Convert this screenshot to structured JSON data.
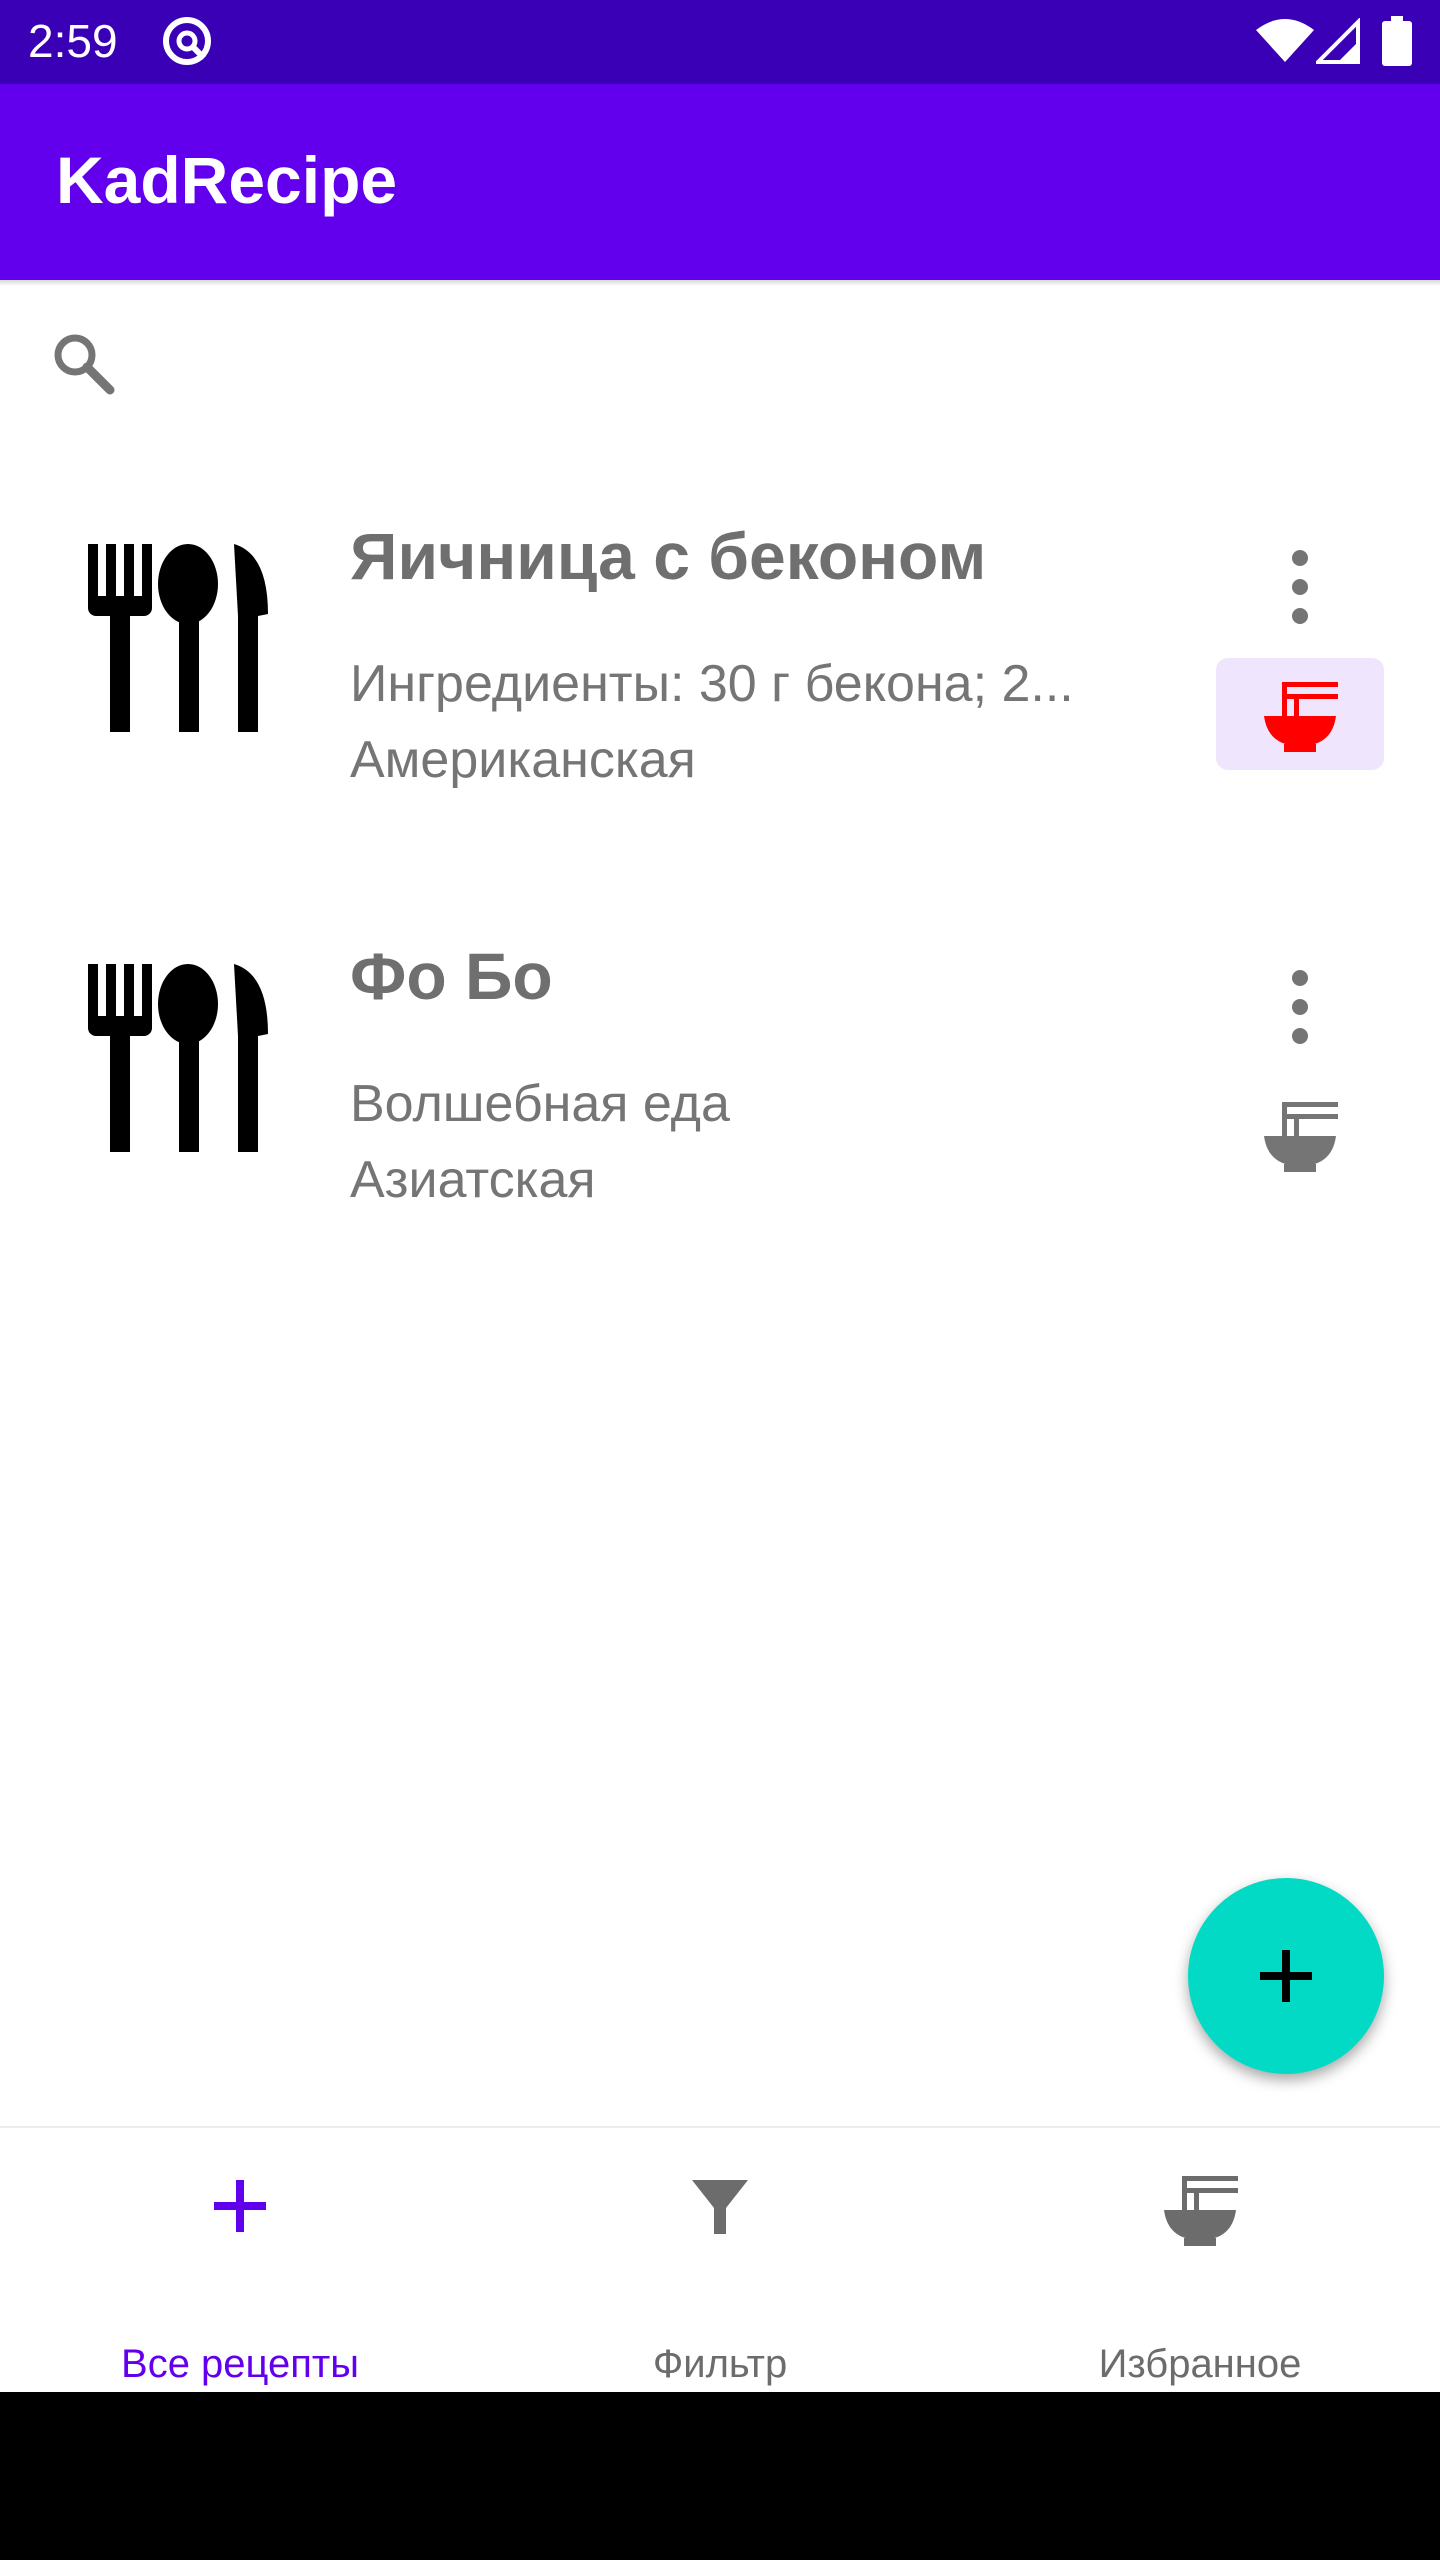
{
  "status_bar": {
    "time": "2:59"
  },
  "app": {
    "title": "KadRecipe"
  },
  "search": {
    "placeholder": ""
  },
  "recipes": [
    {
      "name": "Яичница с беконом",
      "description": "Ингредиенты:  30 г бекона; 2...",
      "cuisine": "Американская",
      "favorite": true
    },
    {
      "name": "Фо Бо",
      "description": "Волшебная еда",
      "cuisine": "Азиатская",
      "favorite": false
    }
  ],
  "bottom_nav": {
    "items": [
      {
        "label": "Все рецепты",
        "icon": "plus-icon",
        "active": true
      },
      {
        "label": "Фильтр",
        "icon": "filter-icon",
        "active": false
      },
      {
        "label": "Избранное",
        "icon": "noodle-bowl-icon",
        "active": false
      }
    ]
  },
  "colors": {
    "status_bar": "#3a00b5",
    "app_bar": "#6200ee",
    "fab": "#03dac5",
    "favorite_active": "#ff0000",
    "favorite_inactive": "#757575",
    "nav_active": "#6200ee"
  }
}
